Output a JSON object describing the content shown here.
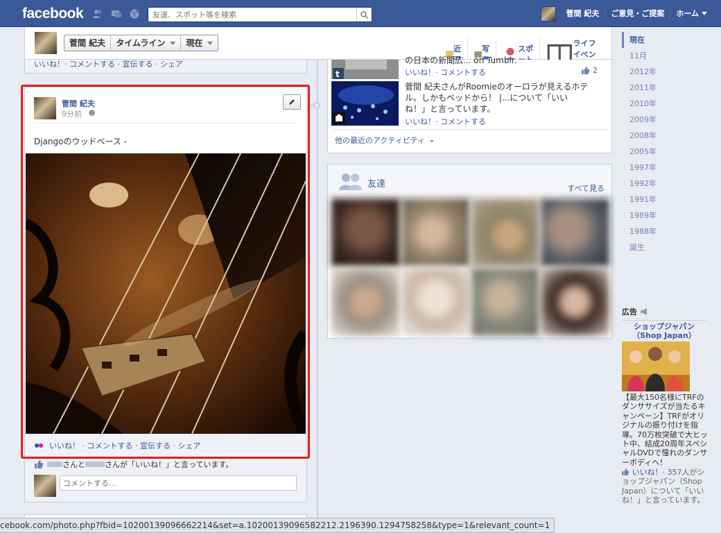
{
  "topbar": {
    "logo": "facebook",
    "search_placeholder": "友達、スポット等を検索",
    "user_name": "菅間 紀夫",
    "feedback": "ご意見・ご提案",
    "home": "ホーム"
  },
  "subbar": {
    "name": "菅間 紀夫",
    "timeline": "タイムライン",
    "now": "現在",
    "links": [
      "近況",
      "写真",
      "スポット",
      "ライフイベント"
    ]
  },
  "top_card": {
    "actions": "いいね！· コメントする · 宣伝する · シェア"
  },
  "post": {
    "author": "菅間 紀夫",
    "time": "9分前",
    "text": "Djangoのウッドベース -",
    "actions": "いいね！ · コメントする · 宣伝する · シェア",
    "likes": "さんと",
    "likes_tail": "さんが「いいね！」と言っています。",
    "comment_placeholder": "コメントする..."
  },
  "activity": {
    "row1_text": "の日本の新聞広... on Tumblr.",
    "row1_meta": "いいね！· コメントする",
    "row1_count": "2",
    "row2_text_1": "菅間 紀夫さんがRoomieのオーロラが見えるホテ",
    "row2_text_2": "ル。しかもベッドから！ |...について「いい",
    "row2_text_3": "ね！」と言っています。",
    "row2_meta": "いいね！· コメントする",
    "more": "他の最近のアクティビティ"
  },
  "friends": {
    "title": "友達",
    "see_all": "すべて見る"
  },
  "years": [
    "現在",
    "11月",
    "2012年",
    "2011年",
    "2010年",
    "2009年",
    "2008年",
    "2005年",
    "1997年",
    "1992年",
    "1991年",
    "1989年",
    "1988年",
    "誕生"
  ],
  "ad": {
    "header": "広告",
    "title_1": "ショップジャパン",
    "title_2": "（Shop Japan）",
    "body": "【最大150名様にTRFのダンササイズが当たるキャンペーン】TRFがオリジナルの振り付けを指導。70万枚突破で大ヒット中、結成20周年スペシャルDVDで憧れのダンサーボディへ！",
    "like_label": "いいね！",
    "like_text": "· 357人がショップジャパン（Shop Japan）について「いいね！」と言っています。"
  },
  "status_url": "cebook.com/photo.php?fbid=10200139096662214&set=a.10200139096582212.2196390.1294758258&type=1&relevant_count=1",
  "colors": {
    "brand_blue": "#3b5998",
    "highlight_red": "#dd1f1f",
    "page_bg": "#e9ebf2"
  }
}
